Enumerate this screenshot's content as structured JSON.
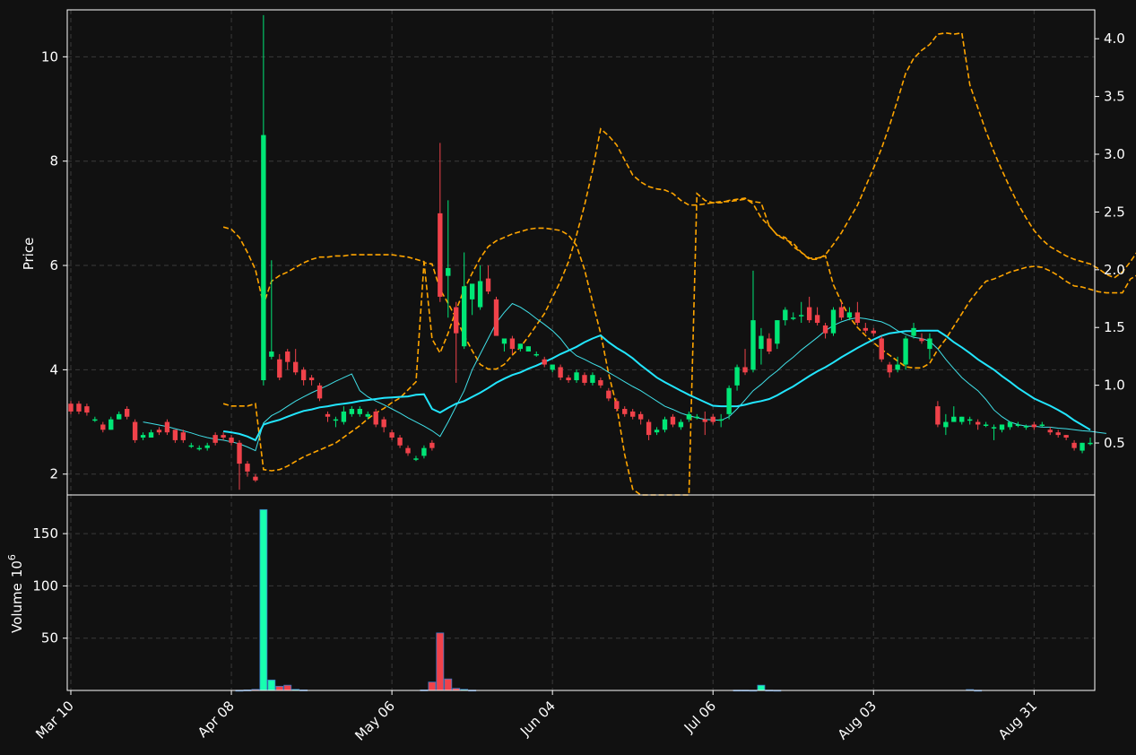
{
  "chart_data": {
    "type": "candlestick",
    "style": {
      "background": "#111111",
      "up_color": "#00e676",
      "down_color": "#f0424a",
      "volume_up": "#18ffb0",
      "volume_down": "#f0424a",
      "ma_fast_color": "#40e0e8",
      "ma_slow_color": "#22e6ff",
      "band_color": "#ffa500",
      "grid": true
    },
    "price_panel": {
      "ylabel": "Price",
      "ylim": [
        1.6,
        10.9
      ],
      "yticks": [
        "2",
        "4",
        "6",
        "8",
        "10"
      ],
      "right_ylim": [
        0.05,
        4.25
      ],
      "right_yticks": [
        "0.5",
        "1.0",
        "1.5",
        "2.0",
        "2.5",
        "3.0",
        "3.5",
        "4.0"
      ]
    },
    "volume_panel": {
      "ylabel": "Volume",
      "ylabel_exponent": "10",
      "ylabel_exponent_power": "6",
      "ylim": [
        0,
        187
      ],
      "yticks": [
        "50",
        "100",
        "150"
      ]
    },
    "x_tick_labels": [
      "Mar 10",
      "Apr 08",
      "May 06",
      "Jun 04",
      "Jul 06",
      "Aug 03",
      "Aug 31"
    ],
    "candles": [
      [
        3.35,
        3.4,
        3.15,
        3.2
      ],
      [
        3.35,
        3.4,
        3.15,
        3.2
      ],
      [
        3.3,
        3.35,
        3.12,
        3.18
      ],
      [
        3.05,
        3.1,
        3.0,
        3.05
      ],
      [
        2.95,
        3.0,
        2.8,
        2.85
      ],
      [
        2.85,
        3.1,
        2.85,
        3.05
      ],
      [
        3.05,
        3.2,
        3.05,
        3.15
      ],
      [
        3.25,
        3.3,
        3.05,
        3.1
      ],
      [
        3.0,
        3.05,
        2.6,
        2.65
      ],
      [
        2.7,
        2.8,
        2.65,
        2.75
      ],
      [
        2.7,
        2.85,
        2.7,
        2.8
      ],
      [
        2.85,
        2.9,
        2.75,
        2.8
      ],
      [
        3.0,
        3.05,
        2.75,
        2.8
      ],
      [
        2.85,
        2.85,
        2.6,
        2.65
      ],
      [
        2.8,
        2.85,
        2.6,
        2.65
      ],
      [
        2.55,
        2.6,
        2.5,
        2.55
      ],
      [
        2.5,
        2.55,
        2.45,
        2.5
      ],
      [
        2.5,
        2.6,
        2.45,
        2.55
      ],
      [
        2.75,
        2.8,
        2.55,
        2.6
      ],
      [
        2.75,
        2.8,
        2.65,
        2.7
      ],
      [
        2.7,
        2.75,
        2.55,
        2.6
      ],
      [
        2.6,
        2.65,
        1.7,
        2.2
      ],
      [
        2.2,
        2.25,
        1.95,
        2.05
      ],
      [
        1.95,
        2.0,
        1.85,
        1.88
      ],
      [
        3.8,
        10.8,
        3.7,
        8.5
      ],
      [
        4.25,
        6.1,
        4.2,
        4.35
      ],
      [
        4.2,
        4.3,
        3.8,
        3.85
      ],
      [
        4.35,
        4.4,
        4.0,
        4.15
      ],
      [
        4.15,
        4.4,
        3.9,
        3.95
      ],
      [
        4.0,
        4.05,
        3.7,
        3.8
      ],
      [
        3.85,
        3.9,
        3.7,
        3.8
      ],
      [
        3.7,
        3.75,
        3.4,
        3.45
      ],
      [
        3.15,
        3.2,
        3.0,
        3.1
      ],
      [
        3.05,
        3.1,
        2.9,
        3.05
      ],
      [
        3.0,
        3.3,
        2.95,
        3.2
      ],
      [
        3.15,
        3.3,
        3.1,
        3.25
      ],
      [
        3.15,
        3.3,
        3.1,
        3.25
      ],
      [
        3.1,
        3.2,
        3.05,
        3.15
      ],
      [
        3.2,
        3.25,
        2.9,
        2.95
      ],
      [
        3.05,
        3.1,
        2.8,
        2.9
      ],
      [
        2.8,
        2.85,
        2.65,
        2.7
      ],
      [
        2.7,
        2.75,
        2.5,
        2.55
      ],
      [
        2.5,
        2.55,
        2.35,
        2.4
      ],
      [
        2.3,
        2.35,
        2.25,
        2.3
      ],
      [
        2.35,
        2.55,
        2.3,
        2.5
      ],
      [
        2.6,
        2.65,
        2.45,
        2.5
      ],
      [
        7.0,
        8.35,
        5.3,
        5.4
      ],
      [
        5.8,
        7.25,
        5.0,
        5.95
      ],
      [
        5.2,
        5.3,
        3.75,
        4.7
      ],
      [
        4.45,
        6.25,
        4.4,
        5.6
      ],
      [
        5.35,
        5.6,
        5.05,
        5.65
      ],
      [
        5.2,
        6.0,
        5.15,
        5.7
      ],
      [
        5.75,
        6.0,
        5.45,
        5.5
      ],
      [
        5.35,
        5.4,
        4.7,
        4.65
      ],
      [
        4.5,
        4.55,
        4.35,
        4.6
      ],
      [
        4.6,
        4.65,
        4.3,
        4.4
      ],
      [
        4.4,
        4.5,
        4.35,
        4.5
      ],
      [
        4.35,
        4.45,
        4.35,
        4.45
      ],
      [
        4.3,
        4.35,
        4.25,
        4.3
      ],
      [
        4.2,
        4.25,
        4.05,
        4.1
      ],
      [
        4.0,
        4.1,
        3.95,
        4.1
      ],
      [
        4.05,
        4.1,
        3.8,
        3.85
      ],
      [
        3.85,
        3.9,
        3.75,
        3.8
      ],
      [
        3.8,
        4.0,
        3.75,
        3.95
      ],
      [
        3.9,
        3.95,
        3.7,
        3.75
      ],
      [
        3.75,
        3.95,
        3.7,
        3.9
      ],
      [
        3.8,
        3.85,
        3.65,
        3.7
      ],
      [
        3.6,
        3.65,
        3.4,
        3.45
      ],
      [
        3.4,
        3.45,
        3.2,
        3.25
      ],
      [
        3.25,
        3.3,
        3.1,
        3.15
      ],
      [
        3.2,
        3.25,
        3.05,
        3.1
      ],
      [
        3.15,
        3.2,
        2.95,
        3.05
      ],
      [
        3.0,
        3.05,
        2.65,
        2.75
      ],
      [
        2.8,
        2.9,
        2.75,
        2.85
      ],
      [
        2.85,
        3.1,
        2.8,
        3.05
      ],
      [
        3.1,
        3.15,
        2.9,
        2.95
      ],
      [
        2.9,
        3.05,
        2.85,
        3.0
      ],
      [
        3.05,
        3.2,
        3.0,
        3.15
      ],
      [
        3.1,
        3.15,
        3.05,
        3.1
      ],
      [
        3.05,
        3.2,
        2.75,
        3.0
      ],
      [
        3.1,
        3.15,
        2.95,
        3.0
      ],
      [
        3.05,
        3.15,
        2.9,
        3.05
      ],
      [
        3.15,
        3.7,
        3.05,
        3.65
      ],
      [
        3.7,
        4.1,
        3.6,
        4.05
      ],
      [
        4.05,
        4.4,
        3.9,
        3.95
      ],
      [
        4.0,
        5.9,
        3.95,
        4.95
      ],
      [
        4.4,
        4.8,
        4.1,
        4.65
      ],
      [
        4.6,
        4.7,
        4.3,
        4.35
      ],
      [
        4.5,
        4.95,
        4.4,
        4.95
      ],
      [
        4.95,
        5.2,
        4.85,
        5.15
      ],
      [
        5.0,
        5.1,
        4.95,
        5.0
      ],
      [
        5.05,
        5.3,
        4.9,
        5.05
      ],
      [
        5.2,
        5.4,
        4.9,
        4.95
      ],
      [
        5.05,
        5.2,
        4.85,
        4.9
      ],
      [
        4.85,
        4.9,
        4.6,
        4.7
      ],
      [
        4.7,
        5.2,
        4.65,
        5.15
      ],
      [
        5.2,
        5.3,
        4.95,
        5.0
      ],
      [
        5.0,
        5.2,
        4.95,
        5.1
      ],
      [
        5.1,
        5.3,
        4.85,
        4.9
      ],
      [
        4.8,
        4.9,
        4.7,
        4.75
      ],
      [
        4.75,
        4.8,
        4.65,
        4.7
      ],
      [
        4.6,
        4.65,
        4.15,
        4.2
      ],
      [
        4.1,
        4.15,
        3.85,
        3.95
      ],
      [
        4.0,
        4.25,
        3.95,
        4.1
      ],
      [
        4.1,
        4.65,
        4.0,
        4.6
      ],
      [
        4.65,
        4.9,
        4.6,
        4.8
      ],
      [
        4.6,
        4.7,
        4.5,
        4.55
      ],
      [
        4.4,
        4.7,
        4.2,
        4.6
      ],
      [
        3.3,
        3.4,
        2.9,
        2.95
      ],
      [
        2.9,
        3.15,
        2.75,
        3.0
      ],
      [
        3.0,
        3.3,
        3.0,
        3.1
      ],
      [
        3.0,
        3.1,
        2.95,
        3.1
      ],
      [
        3.05,
        3.1,
        2.95,
        3.05
      ],
      [
        3.0,
        3.05,
        2.85,
        2.95
      ],
      [
        2.95,
        3.0,
        2.9,
        2.95
      ],
      [
        2.9,
        2.95,
        2.65,
        2.9
      ],
      [
        2.85,
        2.95,
        2.8,
        2.95
      ],
      [
        2.9,
        3.0,
        2.85,
        3.0
      ],
      [
        2.95,
        3.0,
        2.9,
        2.95
      ],
      [
        2.9,
        2.95,
        2.85,
        2.92
      ],
      [
        2.95,
        3.0,
        2.85,
        2.9
      ],
      [
        2.95,
        3.0,
        2.9,
        2.95
      ],
      [
        2.85,
        2.9,
        2.75,
        2.8
      ],
      [
        2.8,
        2.85,
        2.7,
        2.75
      ],
      [
        2.75,
        2.75,
        2.65,
        2.7
      ],
      [
        2.6,
        2.65,
        2.45,
        2.5
      ],
      [
        2.45,
        2.6,
        2.4,
        2.6
      ],
      [
        2.6,
        2.7,
        2.55,
        2.6
      ]
    ],
    "volumes_millions": [
      0,
      0,
      0,
      0,
      0,
      0,
      0,
      0,
      0,
      0,
      0,
      0,
      0,
      0,
      0,
      0,
      0,
      0,
      0,
      0,
      0,
      0.2,
      0.5,
      1,
      173,
      10,
      4,
      5,
      1,
      0.5,
      0,
      0,
      0,
      0,
      0,
      0,
      0,
      0,
      0,
      0,
      0,
      0,
      0,
      0,
      0.5,
      8,
      55,
      11,
      2,
      1,
      0.3,
      0,
      0,
      0,
      0,
      0,
      0,
      0,
      0,
      0,
      0,
      0,
      0,
      0,
      0,
      0,
      0,
      0,
      0,
      0,
      0,
      0,
      0,
      0,
      0,
      0,
      0,
      0,
      0,
      0,
      0,
      0,
      0,
      0.3,
      0.3,
      0.2,
      5,
      0.3,
      0.2,
      0,
      0,
      0,
      0,
      0,
      0,
      0,
      0,
      0,
      0,
      0,
      0,
      0,
      0,
      0,
      0,
      0,
      0,
      0,
      0,
      0,
      0,
      0,
      0.8,
      0.2,
      0,
      0,
      0,
      0,
      0,
      0,
      0,
      0,
      0,
      0,
      0,
      0,
      0,
      0,
      0,
      0,
      0,
      0,
      0,
      0,
      0,
      0
    ],
    "volume_direction": [
      0,
      0,
      0,
      0,
      0,
      0,
      0,
      0,
      0,
      0,
      0,
      0,
      0,
      0,
      0,
      0,
      0,
      0,
      0,
      0,
      0,
      0,
      0,
      0,
      1,
      1,
      0,
      0,
      1,
      0,
      0,
      0,
      0,
      0,
      0,
      0,
      0,
      0,
      0,
      0,
      0,
      0,
      0,
      0,
      1,
      0,
      0,
      0,
      0,
      1,
      1,
      0,
      0,
      0,
      0,
      0,
      0,
      0,
      0,
      0,
      0,
      0,
      0,
      0,
      0,
      0,
      0,
      0,
      0,
      0,
      0,
      0,
      0,
      0,
      0,
      0,
      0,
      0,
      0,
      0,
      0,
      0,
      0,
      1,
      1,
      1,
      1,
      1,
      1,
      0,
      0,
      0,
      0,
      0,
      0,
      0,
      0,
      0,
      0,
      0,
      0,
      0,
      0,
      0,
      0,
      0,
      0,
      0,
      0,
      0,
      0,
      0,
      1,
      1,
      0,
      0,
      0,
      0,
      0,
      0,
      0,
      0,
      0,
      0,
      0,
      0,
      0,
      0,
      0,
      0,
      0,
      0,
      0,
      0,
      0,
      0
    ],
    "ma_fast": [
      null,
      null,
      null,
      null,
      null,
      null,
      null,
      null,
      null,
      3.0,
      2.97,
      2.94,
      2.91,
      2.87,
      2.83,
      2.79,
      2.74,
      2.7,
      2.67,
      2.65,
      2.62,
      2.58,
      2.52,
      2.45,
      2.98,
      3.12,
      3.2,
      3.3,
      3.4,
      3.48,
      3.56,
      3.63,
      3.7,
      3.78,
      3.85,
      3.92,
      3.6,
      3.48,
      3.4,
      3.33,
      3.25,
      3.17,
      3.08,
      3.0,
      2.92,
      2.83,
      2.72,
      3.0,
      3.3,
      3.6,
      4.0,
      4.3,
      4.6,
      4.9,
      5.1,
      5.27,
      5.2,
      5.1,
      4.98,
      4.87,
      4.75,
      4.6,
      4.4,
      4.27,
      4.2,
      4.12,
      4.05,
      3.95,
      3.86,
      3.77,
      3.68,
      3.6,
      3.5,
      3.4,
      3.3,
      3.24,
      3.17,
      3.12,
      3.08,
      3.05,
      3.04,
      3.03,
      3.1,
      3.25,
      3.42,
      3.6,
      3.72,
      3.86,
      3.98,
      4.12,
      4.24,
      4.38,
      4.5,
      4.62,
      4.75,
      4.85,
      4.92,
      4.97,
      5.0,
      4.98,
      4.95,
      4.92,
      4.85,
      4.75,
      4.68,
      4.62,
      4.6,
      4.55,
      4.4,
      4.2,
      4.02,
      3.85,
      3.72,
      3.6,
      3.43,
      3.23,
      3.1,
      3.0,
      2.95,
      2.92,
      2.92,
      2.9,
      2.9,
      2.88,
      2.87,
      2.85,
      2.83,
      2.82,
      2.8,
      2.78
    ],
    "ma_slow": [
      null,
      null,
      null,
      null,
      null,
      null,
      null,
      null,
      null,
      null,
      null,
      null,
      null,
      null,
      null,
      null,
      null,
      null,
      null,
      2.82,
      2.8,
      2.77,
      2.72,
      2.65,
      2.95,
      3.0,
      3.04,
      3.1,
      3.16,
      3.21,
      3.24,
      3.28,
      3.3,
      3.33,
      3.35,
      3.37,
      3.4,
      3.42,
      3.44,
      3.46,
      3.47,
      3.48,
      3.49,
      3.52,
      3.53,
      3.25,
      3.18,
      3.27,
      3.35,
      3.4,
      3.48,
      3.56,
      3.65,
      3.75,
      3.83,
      3.9,
      3.95,
      4.02,
      4.08,
      4.15,
      4.22,
      4.3,
      4.37,
      4.44,
      4.53,
      4.6,
      4.66,
      4.53,
      4.42,
      4.33,
      4.22,
      4.09,
      3.97,
      3.85,
      3.76,
      3.68,
      3.6,
      3.52,
      3.45,
      3.38,
      3.31,
      3.3,
      3.3,
      3.3,
      3.33,
      3.37,
      3.4,
      3.44,
      3.51,
      3.6,
      3.68,
      3.78,
      3.88,
      3.97,
      4.05,
      4.14,
      4.24,
      4.33,
      4.42,
      4.5,
      4.58,
      4.65,
      4.7,
      4.72,
      4.74,
      4.74,
      4.75,
      4.75,
      4.75,
      4.65,
      4.53,
      4.43,
      4.32,
      4.2,
      4.1,
      4.0,
      3.88,
      3.77,
      3.65,
      3.55,
      3.45,
      3.38,
      3.31,
      3.23,
      3.14,
      3.03,
      2.94,
      2.85
    ],
    "band_upper": [
      null,
      null,
      null,
      null,
      null,
      null,
      null,
      null,
      null,
      null,
      null,
      null,
      null,
      null,
      null,
      null,
      null,
      null,
      null,
      2.37,
      2.35,
      2.28,
      2.15,
      2.0,
      1.7,
      1.9,
      1.95,
      1.98,
      2.02,
      2.06,
      2.09,
      2.11,
      2.11,
      2.12,
      2.12,
      2.13,
      2.13,
      2.13,
      2.13,
      2.13,
      2.13,
      2.12,
      2.11,
      2.09,
      2.07,
      1.4,
      1.28,
      1.45,
      1.65,
      1.83,
      1.97,
      2.1,
      2.2,
      2.25,
      2.28,
      2.31,
      2.33,
      2.35,
      2.36,
      2.36,
      2.35,
      2.34,
      2.3,
      2.21,
      2.0,
      1.72,
      1.45,
      1.1,
      0.82,
      0.4,
      0.1,
      0.01,
      0.0,
      -0.05,
      -0.1,
      -0.15,
      -0.3,
      -0.5,
      2.66,
      2.6,
      2.58,
      2.58,
      2.6,
      2.61,
      2.62,
      2.57,
      2.45,
      2.38,
      2.3,
      2.26,
      2.23,
      2.15,
      2.09,
      2.09,
      2.13,
      2.22,
      2.32,
      2.44,
      2.56,
      2.72,
      2.88,
      3.05,
      3.25,
      3.47,
      3.7,
      3.83,
      3.9,
      3.95,
      4.04,
      4.05,
      4.04,
      4.05,
      3.6,
      3.4,
      3.2,
      3.02,
      2.86,
      2.71,
      2.57,
      2.45,
      2.34,
      2.26,
      2.2,
      2.16,
      2.12,
      2.09,
      2.07,
      2.05,
      2.01,
      1.96,
      1.93,
      1.98,
      2.07,
      2.17,
      2.55
    ],
    "band_mid": [
      null,
      null,
      null,
      null,
      null,
      null,
      null,
      null,
      null,
      null,
      null,
      null,
      null,
      null,
      null,
      null,
      null,
      null,
      null,
      0.84,
      0.82,
      0.82,
      0.82,
      0.84,
      0.27,
      0.26,
      0.27,
      0.3,
      0.34,
      0.38,
      0.41,
      0.44,
      0.47,
      0.5,
      0.55,
      0.6,
      0.65,
      0.71,
      0.76,
      0.8,
      0.85,
      0.89,
      0.96,
      1.03,
      2.06,
      2.05,
      1.83,
      1.71,
      1.58,
      1.43,
      1.3,
      1.18,
      1.14,
      1.14,
      1.18,
      1.26,
      1.33,
      1.42,
      1.52,
      1.62,
      1.76,
      1.9,
      2.07,
      2.3,
      2.56,
      2.86,
      3.22,
      3.16,
      3.08,
      2.95,
      2.82,
      2.76,
      2.72,
      2.7,
      2.69,
      2.66,
      2.6,
      2.56,
      2.56,
      2.57,
      2.58,
      2.59,
      2.59,
      2.6,
      2.61,
      2.59,
      2.58,
      2.38,
      2.3,
      2.28,
      2.2,
      2.15,
      2.1,
      2.1,
      2.12,
      1.87,
      1.72,
      1.59,
      1.5,
      1.43,
      1.37,
      1.31,
      1.26,
      1.21,
      1.16,
      1.15,
      1.15,
      1.19,
      1.31,
      1.4,
      1.51,
      1.62,
      1.73,
      1.82,
      1.9,
      1.92,
      1.95,
      1.98,
      2.0,
      2.02,
      2.03,
      2.02,
      1.99,
      1.95,
      1.9,
      1.86,
      1.85,
      1.83,
      1.81,
      1.8,
      1.8,
      1.8,
      1.92,
      1.96,
      1.98,
      1.97,
      1.95,
      1.94,
      1.91,
      1.87,
      1.81,
      1.75,
      1.69,
      1.62,
      1.57,
      1.53,
      1.51,
      1.46,
      1.38,
      1.24,
      1.08,
      0.79
    ]
  }
}
